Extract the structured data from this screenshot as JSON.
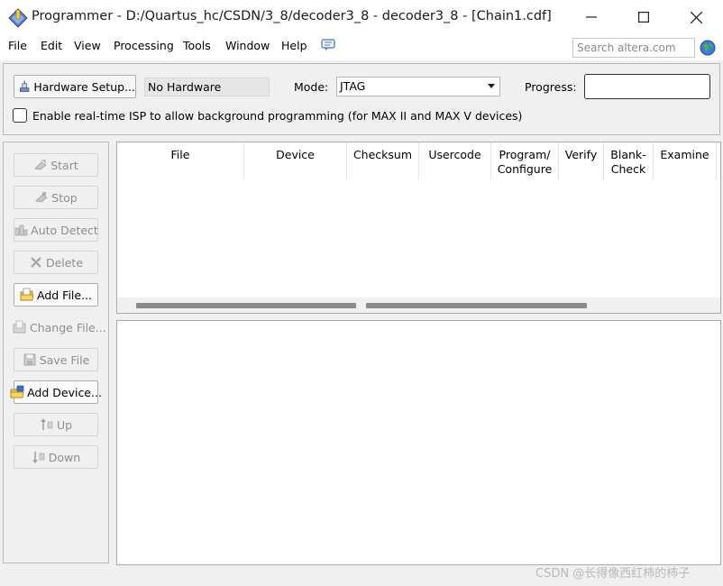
{
  "window": {
    "title": "Programmer - D:/Quartus_hc/CSDN/3_8/decoder3_8 - decoder3_8 - [Chain1.cdf]"
  },
  "menu": {
    "items": [
      "File",
      "Edit",
      "View",
      "Processing",
      "Tools",
      "Window",
      "Help"
    ],
    "search_placeholder": "Search altera.com"
  },
  "hardware": {
    "setup_label": "Hardware Setup...",
    "current": "No Hardware",
    "mode_label": "Mode:",
    "mode_value": "JTAG",
    "progress_label": "Progress:",
    "progress_percent": 0,
    "isp_label": "Enable real-time ISP to allow background programming (for MAX II and MAX V devices)",
    "isp_checked": false
  },
  "side_buttons": [
    {
      "label": "Start",
      "icon": "start-icon",
      "enabled": false
    },
    {
      "label": "Stop",
      "icon": "stop-icon",
      "enabled": false
    },
    {
      "label": "Auto Detect",
      "icon": "auto-detect-icon",
      "enabled": false
    },
    {
      "label": "Delete",
      "icon": "delete-icon",
      "enabled": false
    },
    {
      "label": "Add File...",
      "icon": "add-file-icon",
      "enabled": true
    },
    {
      "label": "Change File...",
      "icon": "change-file-icon",
      "enabled": false
    },
    {
      "label": "Save File",
      "icon": "save-file-icon",
      "enabled": false
    },
    {
      "label": "Add Device...",
      "icon": "add-device-icon",
      "enabled": true
    },
    {
      "label": "Up",
      "icon": "up-icon",
      "enabled": false
    },
    {
      "label": "Down",
      "icon": "down-icon",
      "enabled": false
    }
  ],
  "table": {
    "columns": [
      "File",
      "Device",
      "Checksum",
      "Usercode",
      "Program/\nConfigure",
      "Verify",
      "Blank-\nCheck",
      "Examine"
    ],
    "rows": []
  },
  "watermark": "CSDN @长得像西红柿的柿子"
}
